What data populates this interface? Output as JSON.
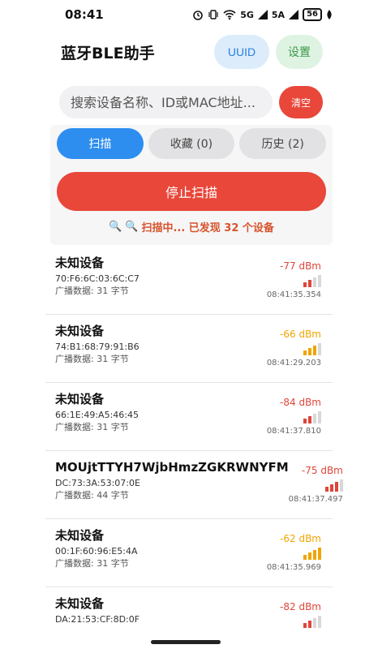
{
  "status_bar": {
    "time": "08:41",
    "network_1": "5G",
    "network_2": "5A",
    "battery": "56"
  },
  "header": {
    "title": "蓝牙BLE助手",
    "uuid_label": "UUID",
    "settings_label": "设置"
  },
  "search": {
    "placeholder": "搜索设备名称、ID或MAC地址...",
    "clear_label": "清空"
  },
  "tabs": [
    {
      "label": "扫描"
    },
    {
      "label": "收藏 (0)"
    },
    {
      "label": "历史 (2)"
    }
  ],
  "scan": {
    "stop_label": "停止扫描",
    "status_text": "扫描中... 已发现 32 个设备"
  },
  "colors": {
    "weak": "#e0453a",
    "medium": "#f0a500"
  },
  "devices": [
    {
      "name": "未知设备",
      "mac": "70:F6:6C:03:6C:C7",
      "adv": "广播数据: 31 字节",
      "rssi": "-77 dBm",
      "time": "08:41:35.354",
      "level": 2,
      "color": "#e0453a"
    },
    {
      "name": "未知设备",
      "mac": "74:B1:68:79:91:B6",
      "adv": "广播数据: 31 字节",
      "rssi": "-66 dBm",
      "time": "08:41:29.203",
      "level": 3,
      "color": "#f0a500"
    },
    {
      "name": "未知设备",
      "mac": "66:1E:49:A5:46:45",
      "adv": "广播数据: 31 字节",
      "rssi": "-84 dBm",
      "time": "08:41:37.810",
      "level": 2,
      "color": "#e0453a"
    },
    {
      "name": "MOUjtTTYH7WjbHmzZGKRWNYFM",
      "mac": "DC:73:3A:53:07:0E",
      "adv": "广播数据: 44 字节",
      "rssi": "-75 dBm",
      "time": "08:41:37.497",
      "level": 3,
      "color": "#e0453a"
    },
    {
      "name": "未知设备",
      "mac": "00:1F:60:96:E5:4A",
      "adv": "广播数据: 31 字节",
      "rssi": "-62 dBm",
      "time": "08:41:35.969",
      "level": 4,
      "color": "#f0a500"
    },
    {
      "name": "未知设备",
      "mac": "DA:21:53:CF:8D:0F",
      "adv": "",
      "rssi": "-82 dBm",
      "time": "",
      "level": 2,
      "color": "#e0453a"
    }
  ]
}
